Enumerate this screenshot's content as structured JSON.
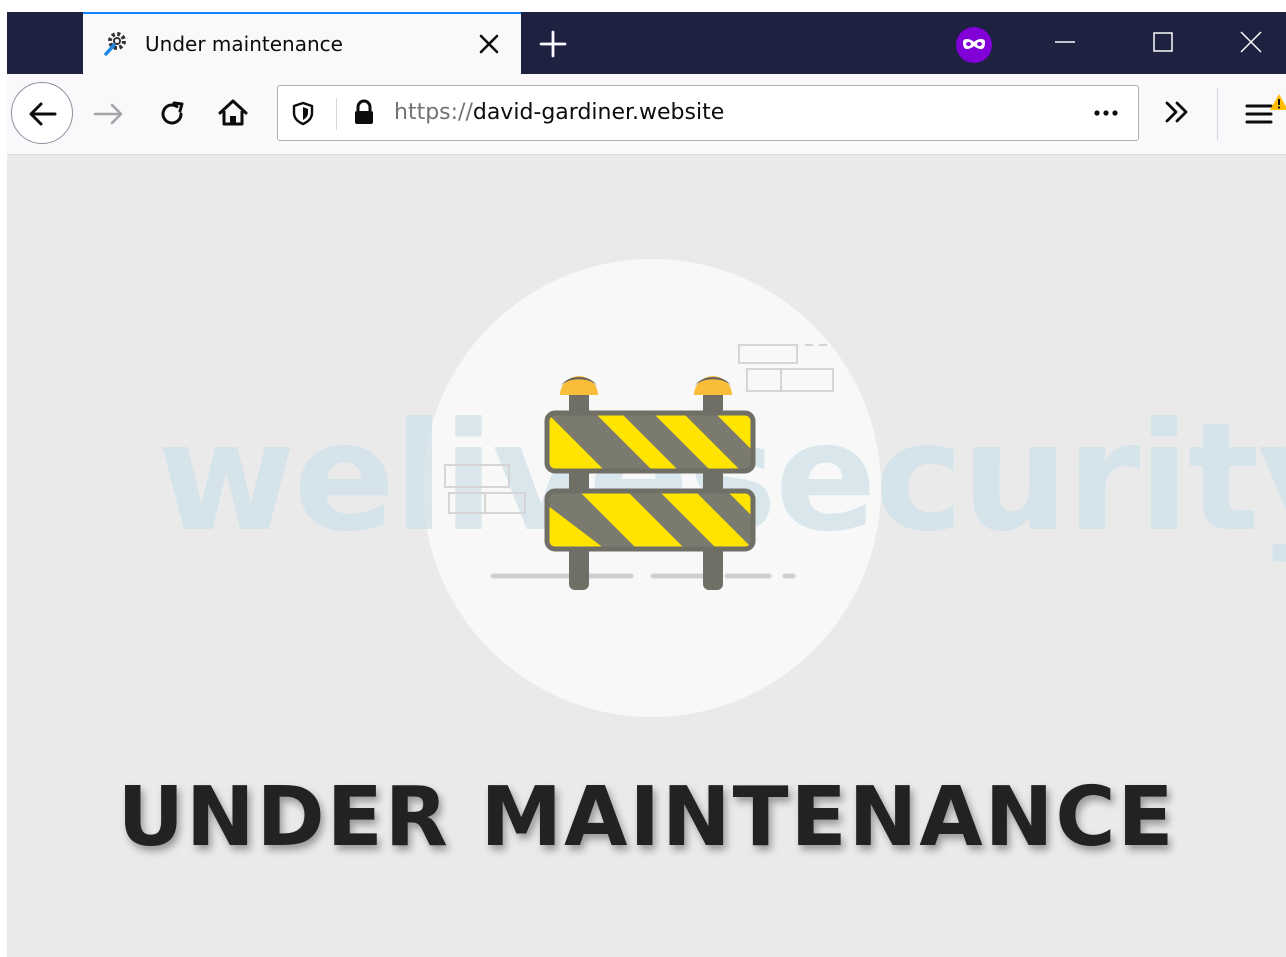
{
  "browser": {
    "tab": {
      "title": "Under maintenance",
      "icon": "gear-wrench-icon"
    },
    "url": {
      "scheme": "https://",
      "host": "david-gardiner.website"
    },
    "theme": {
      "tabstrip": "#1e2140",
      "private_badge": "#8000d7",
      "accent": "#0a84ff"
    }
  },
  "page": {
    "watermark": "welivesecurity",
    "heading": "UNDER MAINTENANCE",
    "illustration": "road-barrier-icon",
    "colors": {
      "background": "#eaeaea",
      "stripe_yellow": "#ffe400",
      "stripe_gray": "#7a7a6e",
      "lamp": "#f9bd3a",
      "heading": "#222222"
    }
  }
}
